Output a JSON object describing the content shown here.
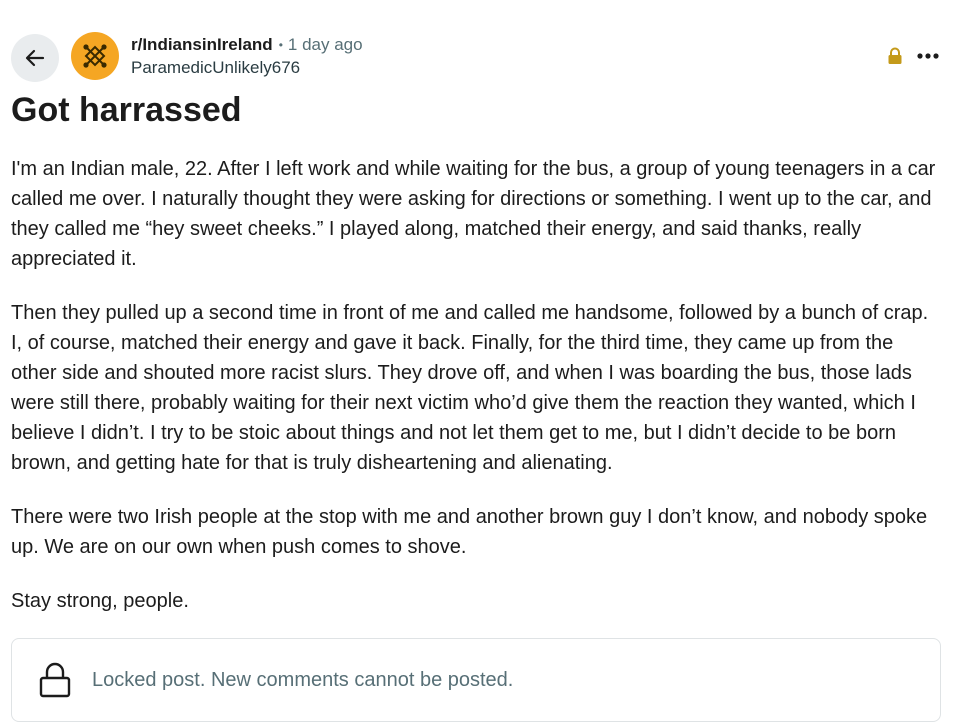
{
  "header": {
    "subreddit": "r/IndiansinIreland",
    "separator": "•",
    "time_ago": "1 day ago",
    "author": "ParamedicUnlikely676",
    "icons": {
      "back": "arrow-left-icon",
      "avatar": "subreddit-avatar-icon",
      "locked": "lock-icon",
      "more": "ellipsis-icon"
    },
    "colors": {
      "avatar_bg": "#f5a623",
      "lock_accent": "#c49a1a",
      "back_bg": "#e9ecee"
    }
  },
  "post": {
    "title": "Got harrassed",
    "paragraphs": [
      "I'm an Indian male, 22. After I left work and while waiting for the bus, a group of young teenagers in a car called me over. I naturally thought they were asking for directions or something. I went up to the car, and they called me “hey sweet cheeks.” I played along, matched their energy, and said thanks, really appreciated it.",
      "Then they pulled up a second time in front of me and called me handsome, followed by a bunch of crap. I, of course, matched their energy and gave it back. Finally, for the third time, they came up from the other side and shouted more racist slurs. They drove off, and when I was boarding the bus, those lads were still there, probably waiting for their next victim who’d give them the reaction they wanted, which I believe I didn’t. I try to be stoic about things and not let them get to me, but I didn’t decide to be born brown, and getting hate for that is truly disheartening and alienating.",
      "There were two Irish people at the stop with me and another brown guy I don’t know, and nobody spoke up. We are on our own when push comes to shove.",
      "Stay strong, people."
    ]
  },
  "locked_notice": {
    "text": "Locked post. New comments cannot be posted.",
    "icon": "lock-outline-icon"
  }
}
